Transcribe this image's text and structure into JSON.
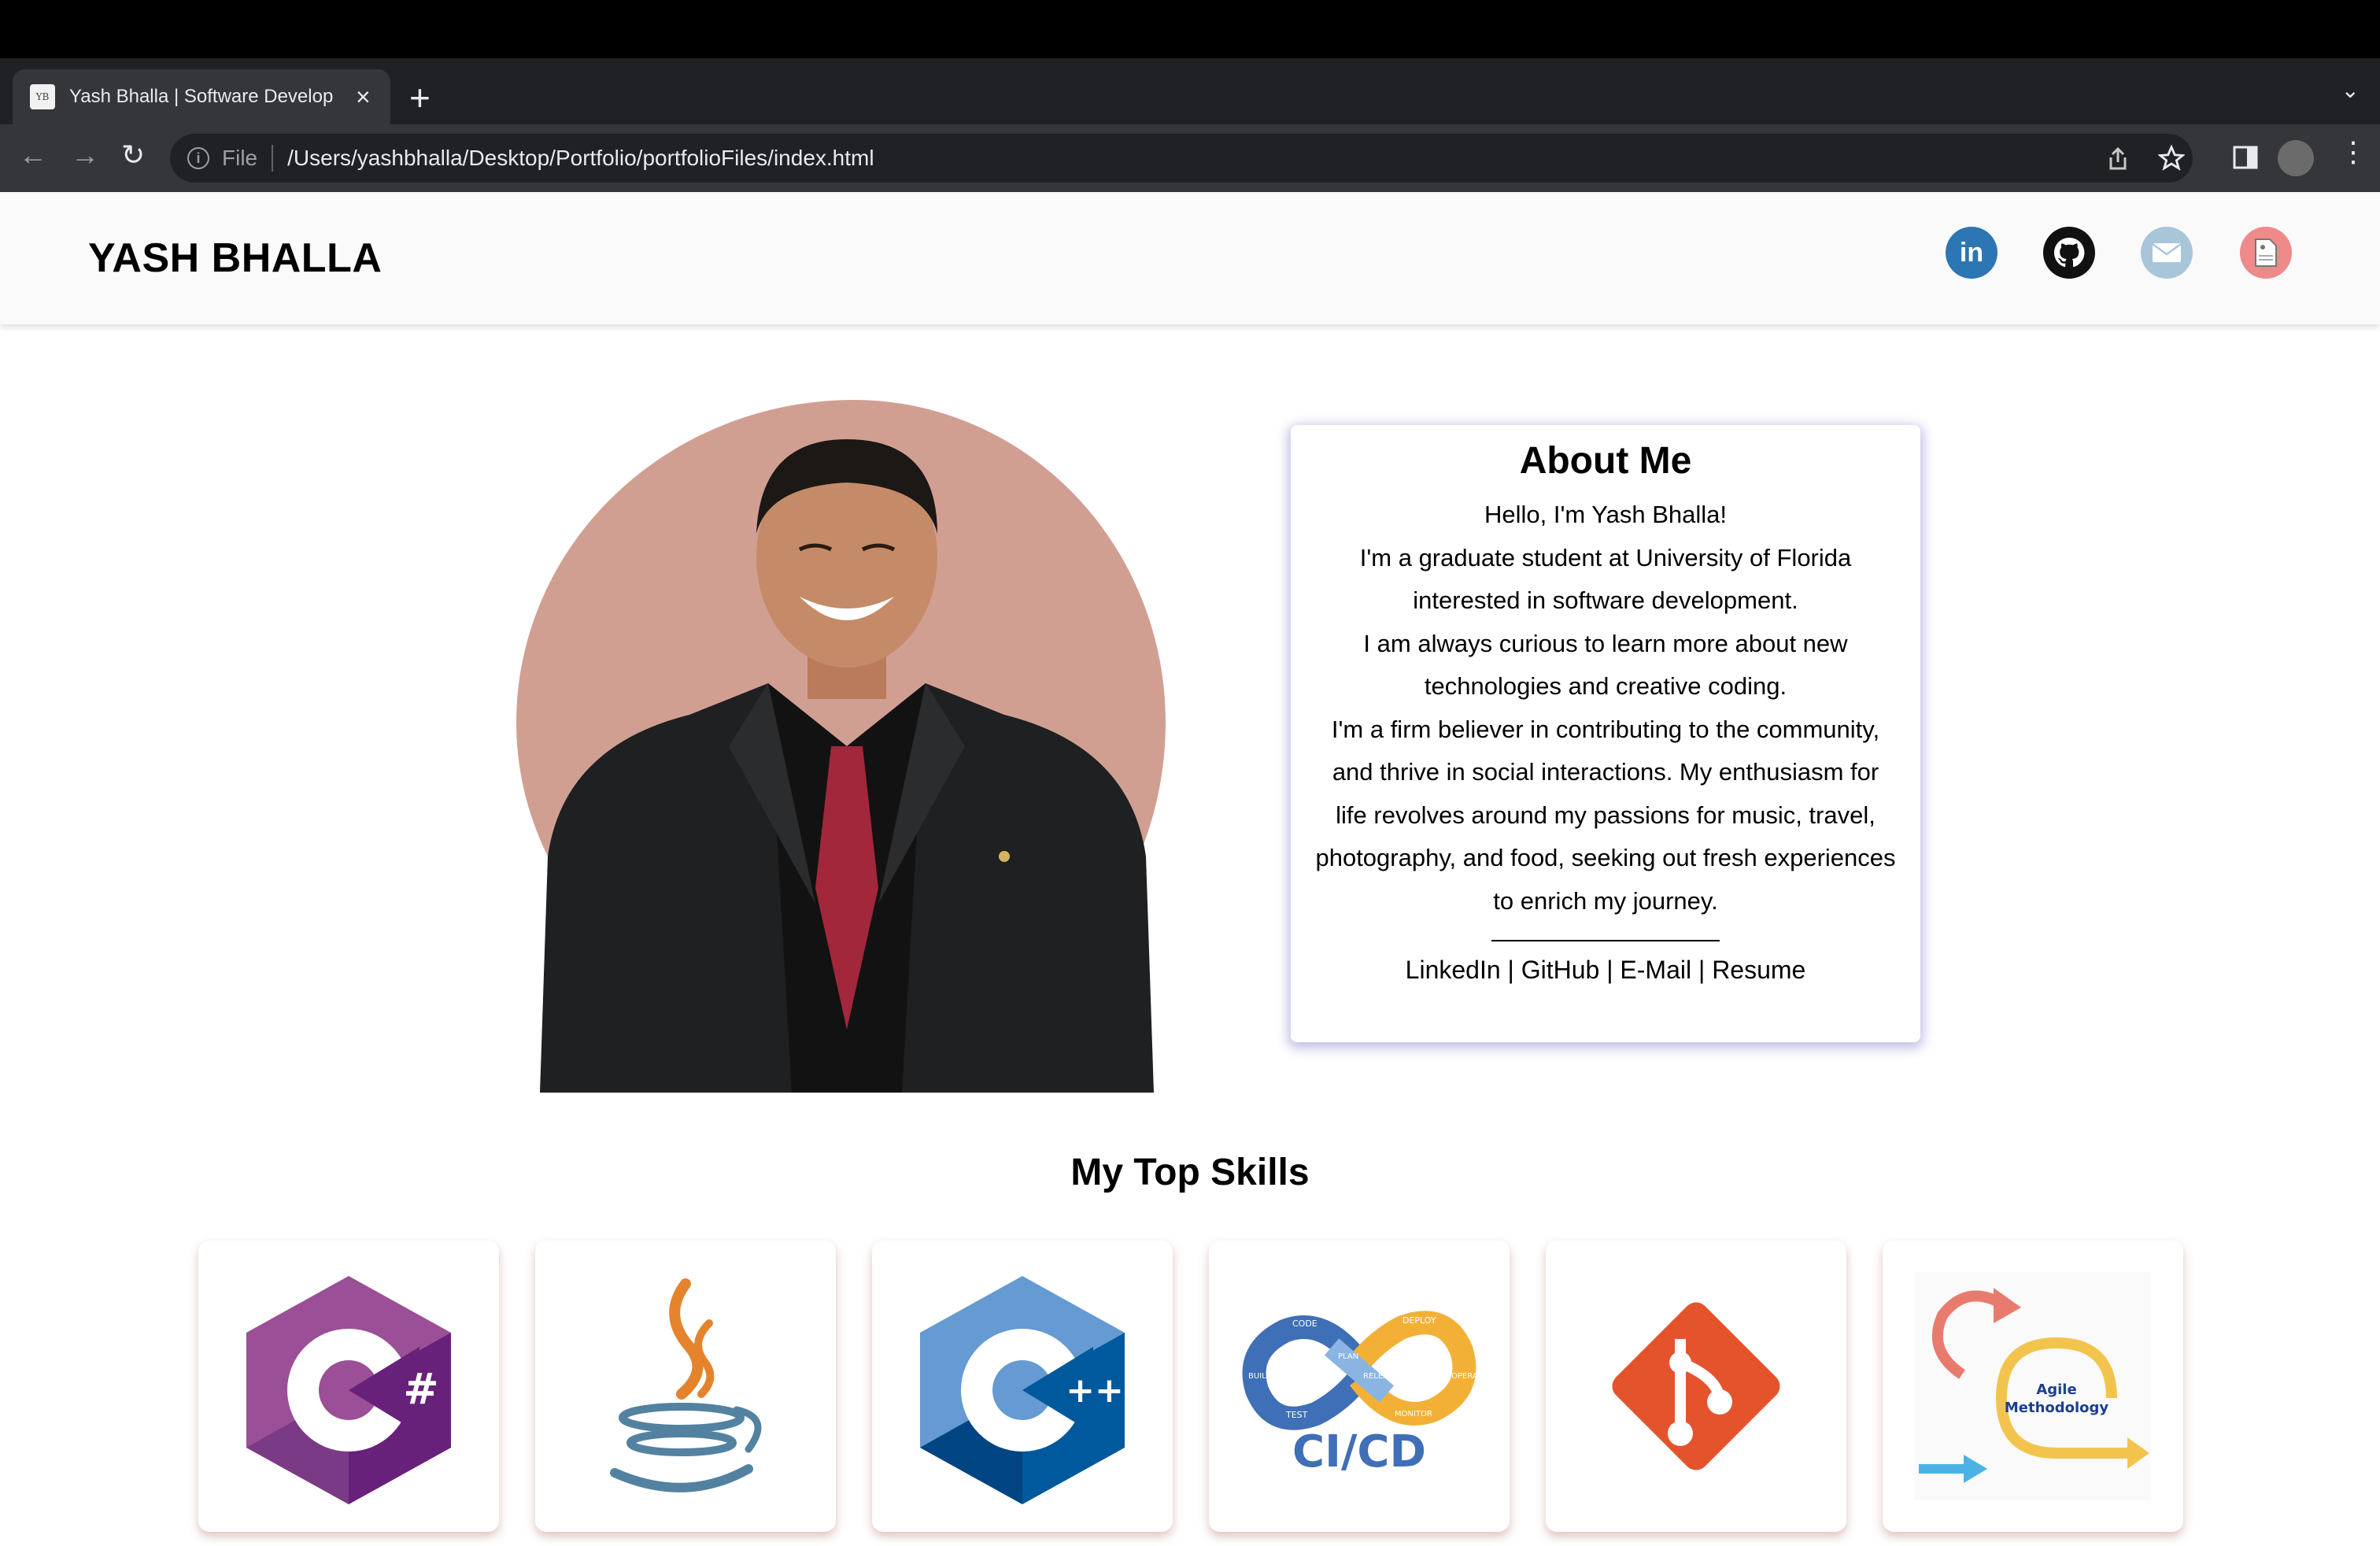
{
  "browser": {
    "tab_title": "Yash Bhalla | Software Develop",
    "tab_favicon_text": "YB",
    "url_scheme_label": "File",
    "url": "/Users/yashbhalla/Desktop/Portfolio/portfolioFiles/index.html"
  },
  "site": {
    "logo": "YASH BHALLA",
    "social": {
      "linkedin_text": "in",
      "icons": [
        "linkedin-icon",
        "github-icon",
        "mail-icon",
        "resume-icon"
      ]
    }
  },
  "about": {
    "title": "About Me",
    "lines": [
      "Hello, I'm Yash Bhalla!",
      "I'm a graduate student at University of Florida",
      "interested in software development.",
      "I am always curious to learn more about new",
      "technologies and creative coding.",
      "I'm a firm believer in contributing to the community,",
      "and thrive in social interactions. My enthusiasm for",
      "life revolves around my passions for music, travel,",
      "photography, and food, seeking out fresh experiences",
      "to enrich my journey."
    ],
    "links": {
      "linkedin": "LinkedIn",
      "github": "GitHub",
      "email": "E-Mail",
      "resume": "Resume",
      "separator": " | "
    }
  },
  "skills": {
    "title": "My Top Skills",
    "csharp_glyph": "#",
    "cpp_glyph": "++",
    "cicd_label": "CI/CD",
    "cicd_code": "CODE",
    "cicd_test": "TEST",
    "cicd_deploy": "DEPLOY",
    "cicd_build": "BUILD",
    "cicd_monitor": "MONITOR",
    "cicd_release": "RELEASE",
    "cicd_operate": "OPERATE",
    "cicd_plan": "PLAN",
    "agile_line1": "Agile",
    "agile_line2": "Methodology"
  },
  "colors": {
    "blob": "#d19f92",
    "csharp": "#9b4f96",
    "cpp": "#5e8ed1",
    "git": "#e5532d",
    "linkedin": "#2d76b4"
  }
}
